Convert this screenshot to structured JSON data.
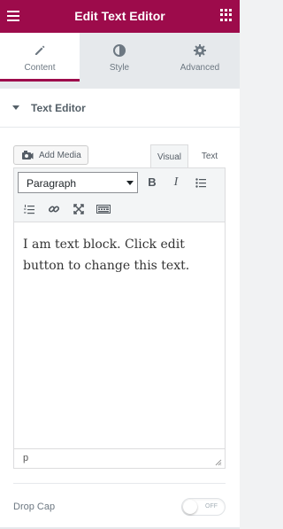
{
  "header": {
    "title": "Edit Text Editor",
    "menu_icon": "hamburger-icon",
    "apps_icon": "grid-icon"
  },
  "tabs": [
    {
      "label": "Content",
      "icon": "pencil-icon",
      "active": true
    },
    {
      "label": "Style",
      "icon": "half-circle-icon",
      "active": false
    },
    {
      "label": "Advanced",
      "icon": "gear-icon",
      "active": false
    }
  ],
  "section": {
    "title": "Text Editor"
  },
  "editor": {
    "add_media_label": "Add Media",
    "mode_tabs": [
      "Visual",
      "Text"
    ],
    "active_mode": "Visual",
    "format_selected": "Paragraph",
    "toolbar_icons": [
      "bold-icon",
      "italic-icon",
      "bullet-list-icon",
      "numbered-list-icon",
      "link-icon",
      "fullscreen-icon",
      "toolbar-toggle-icon"
    ],
    "content": "I am text block. Click edit button to change this text.",
    "path": "p"
  },
  "drop_cap": {
    "label": "Drop Cap",
    "state": "OFF"
  },
  "colors": {
    "brand": "#9d0b4b",
    "panel_bg": "#ffffff",
    "tabs_bg": "#e6e9ec"
  }
}
